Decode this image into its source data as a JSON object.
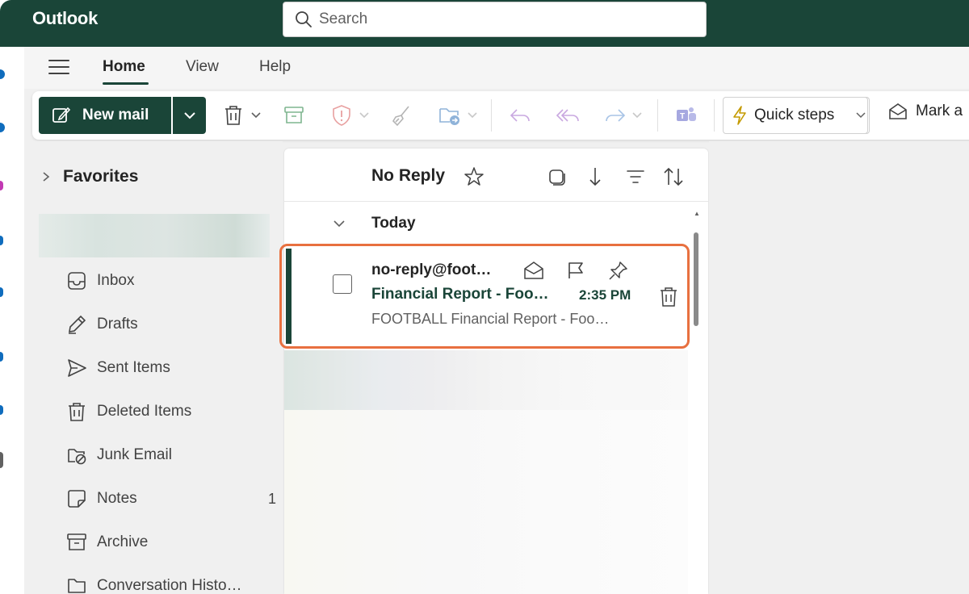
{
  "app": {
    "title": "Outlook"
  },
  "search": {
    "placeholder": "Search"
  },
  "tabs": [
    {
      "label": "Home",
      "active": true
    },
    {
      "label": "View",
      "active": false
    },
    {
      "label": "Help",
      "active": false
    }
  ],
  "ribbon": {
    "new_mail_label": "New mail",
    "quick_steps_label": "Quick steps",
    "mark_all_label": "Mark a"
  },
  "folders": {
    "favorites_label": "Favorites",
    "items": [
      {
        "label": "Inbox",
        "icon": "inbox-icon",
        "count": ""
      },
      {
        "label": "Drafts",
        "icon": "pencil-icon",
        "count": ""
      },
      {
        "label": "Sent Items",
        "icon": "send-icon",
        "count": ""
      },
      {
        "label": "Deleted Items",
        "icon": "trash-icon",
        "count": ""
      },
      {
        "label": "Junk Email",
        "icon": "junk-icon",
        "count": ""
      },
      {
        "label": "Notes",
        "icon": "note-icon",
        "count": "1"
      },
      {
        "label": "Archive",
        "icon": "archive-icon",
        "count": ""
      },
      {
        "label": "Conversation Histo…",
        "icon": "folder-icon",
        "count": ""
      }
    ]
  },
  "message_list": {
    "title": "No Reply",
    "group_label": "Today",
    "messages": [
      {
        "sender": "no-reply@foot…",
        "subject": "Financial Report - Foo…",
        "time": "2:35 PM",
        "preview": "FOOTBALL Financial Report - Foo…",
        "unread": true
      }
    ]
  },
  "colors": {
    "brand": "#1a4538",
    "highlight": "#e8703f"
  }
}
